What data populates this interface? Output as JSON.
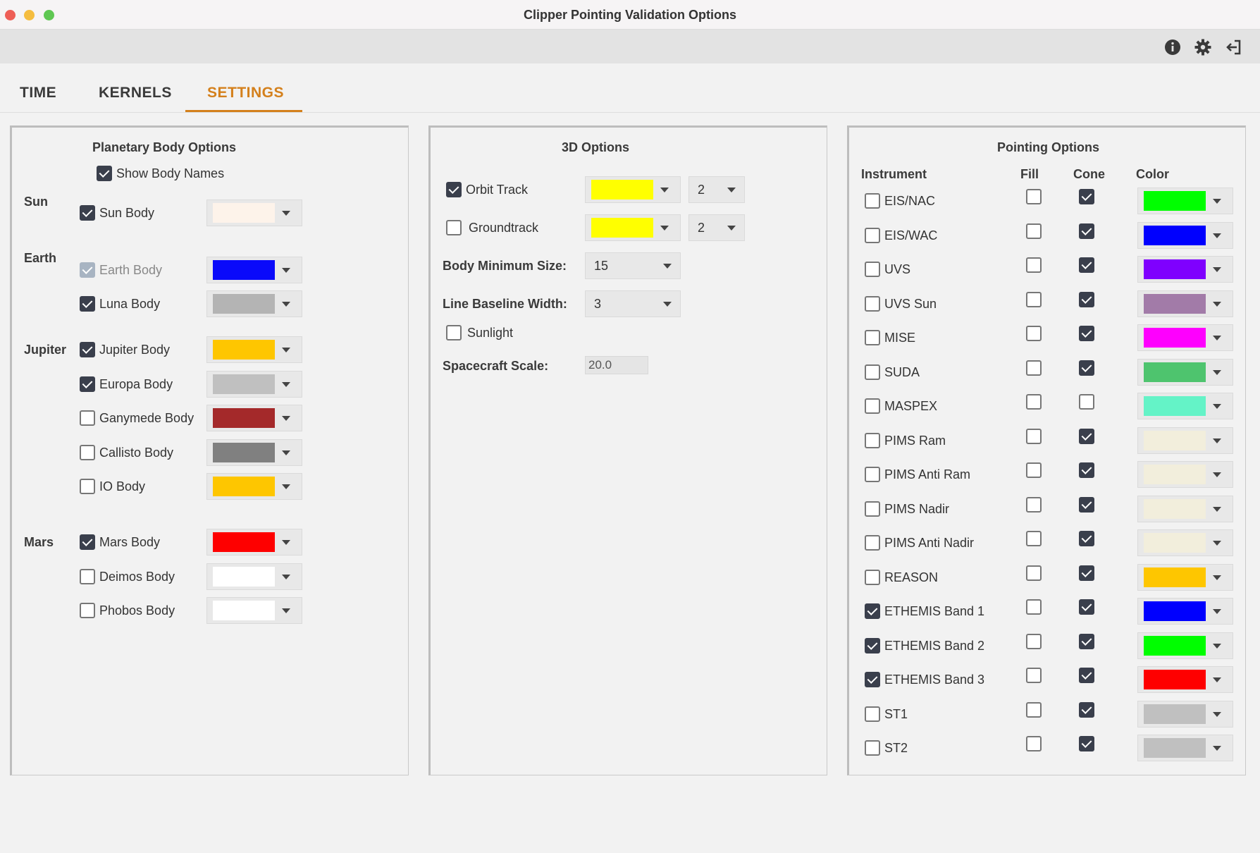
{
  "window": {
    "title": "Clipper Pointing Validation Options"
  },
  "tabs": [
    {
      "label": "TIME",
      "active": false
    },
    {
      "label": "KERNELS",
      "active": false
    },
    {
      "label": "SETTINGS",
      "active": true
    }
  ],
  "toolbar": {
    "icons": [
      "info-icon",
      "gear-icon",
      "logout-icon"
    ]
  },
  "colors": {
    "accent": "#d4801c",
    "checkbox": "#3a3f4c"
  },
  "planetary": {
    "title": "Planetary Body Options",
    "show_body_names": {
      "label": "Show Body Names",
      "checked": true
    },
    "groups": {
      "sun": "Sun",
      "earth": "Earth",
      "jupiter": "Jupiter",
      "mars": "Mars"
    },
    "bodies": [
      {
        "label": "Sun Body",
        "checked": true,
        "color": "#fdf3ea"
      },
      {
        "label": "Earth Body",
        "checked": true,
        "disabled": true,
        "color": "#0a0afa"
      },
      {
        "label": "Luna Body",
        "checked": true,
        "color": "#b4b4b4"
      },
      {
        "label": "Jupiter Body",
        "checked": true,
        "color": "#fec600"
      },
      {
        "label": "Europa Body",
        "checked": true,
        "color": "#c0c0c0"
      },
      {
        "label": "Ganymede Body",
        "checked": false,
        "color": "#a4292a"
      },
      {
        "label": "Callisto Body",
        "checked": false,
        "color": "#808080"
      },
      {
        "label": "IO Body",
        "checked": false,
        "color": "#fec600"
      },
      {
        "label": "Mars Body",
        "checked": true,
        "color": "#fe0000"
      },
      {
        "label": "Deimos Body",
        "checked": false,
        "color": "#ffffff"
      },
      {
        "label": "Phobos Body",
        "checked": false,
        "color": "#ffffff"
      }
    ]
  },
  "options3d": {
    "title": "3D Options",
    "orbit_track": {
      "label": "Orbit Track",
      "checked": true,
      "color": "#ffff00",
      "width": "2"
    },
    "groundtrack": {
      "label": "Groundtrack",
      "checked": false,
      "color": "#ffff00",
      "width": "2"
    },
    "body_min_size": {
      "label": "Body Minimum Size:",
      "value": "15"
    },
    "line_baseline_width": {
      "label": "Line Baseline Width:",
      "value": "3"
    },
    "sunlight": {
      "label": "Sunlight",
      "checked": false
    },
    "spacecraft_scale": {
      "label": "Spacecraft Scale:",
      "value": "20.0"
    }
  },
  "pointing": {
    "title": "Pointing Options",
    "headers": {
      "instrument": "Instrument",
      "fill": "Fill",
      "cone": "Cone",
      "color": "Color"
    },
    "instruments": [
      {
        "label": "EIS/NAC",
        "checked": false,
        "fill": false,
        "cone": true,
        "color": "#00fe00"
      },
      {
        "label": "EIS/WAC",
        "checked": false,
        "fill": false,
        "cone": true,
        "color": "#0000fe"
      },
      {
        "label": "UVS",
        "checked": false,
        "fill": false,
        "cone": true,
        "color": "#7f00fe"
      },
      {
        "label": "UVS Sun",
        "checked": false,
        "fill": false,
        "cone": true,
        "color": "#a27ba8"
      },
      {
        "label": "MISE",
        "checked": false,
        "fill": false,
        "cone": true,
        "color": "#fe00fe"
      },
      {
        "label": "SUDA",
        "checked": false,
        "fill": false,
        "cone": true,
        "color": "#4ec46e"
      },
      {
        "label": "MASPEX",
        "checked": false,
        "fill": false,
        "cone": false,
        "color": "#64f3c7"
      },
      {
        "label": "PIMS Ram",
        "checked": false,
        "fill": false,
        "cone": true,
        "color": "#f2eedc"
      },
      {
        "label": "PIMS Anti Ram",
        "checked": false,
        "fill": false,
        "cone": true,
        "color": "#f2eedc"
      },
      {
        "label": "PIMS Nadir",
        "checked": false,
        "fill": false,
        "cone": true,
        "color": "#f2eedc"
      },
      {
        "label": "PIMS Anti Nadir",
        "checked": false,
        "fill": false,
        "cone": true,
        "color": "#f2eedc"
      },
      {
        "label": "REASON",
        "checked": false,
        "fill": false,
        "cone": true,
        "color": "#fec600"
      },
      {
        "label": "ETHEMIS Band 1",
        "checked": true,
        "fill": false,
        "cone": true,
        "color": "#0000fe"
      },
      {
        "label": "ETHEMIS Band 2",
        "checked": true,
        "fill": false,
        "cone": true,
        "color": "#00fe00"
      },
      {
        "label": "ETHEMIS Band 3",
        "checked": true,
        "fill": false,
        "cone": true,
        "color": "#fe0000"
      },
      {
        "label": "ST1",
        "checked": false,
        "fill": false,
        "cone": true,
        "color": "#c0c0c0"
      },
      {
        "label": "ST2",
        "checked": false,
        "fill": false,
        "cone": true,
        "color": "#c0c0c0"
      }
    ]
  }
}
